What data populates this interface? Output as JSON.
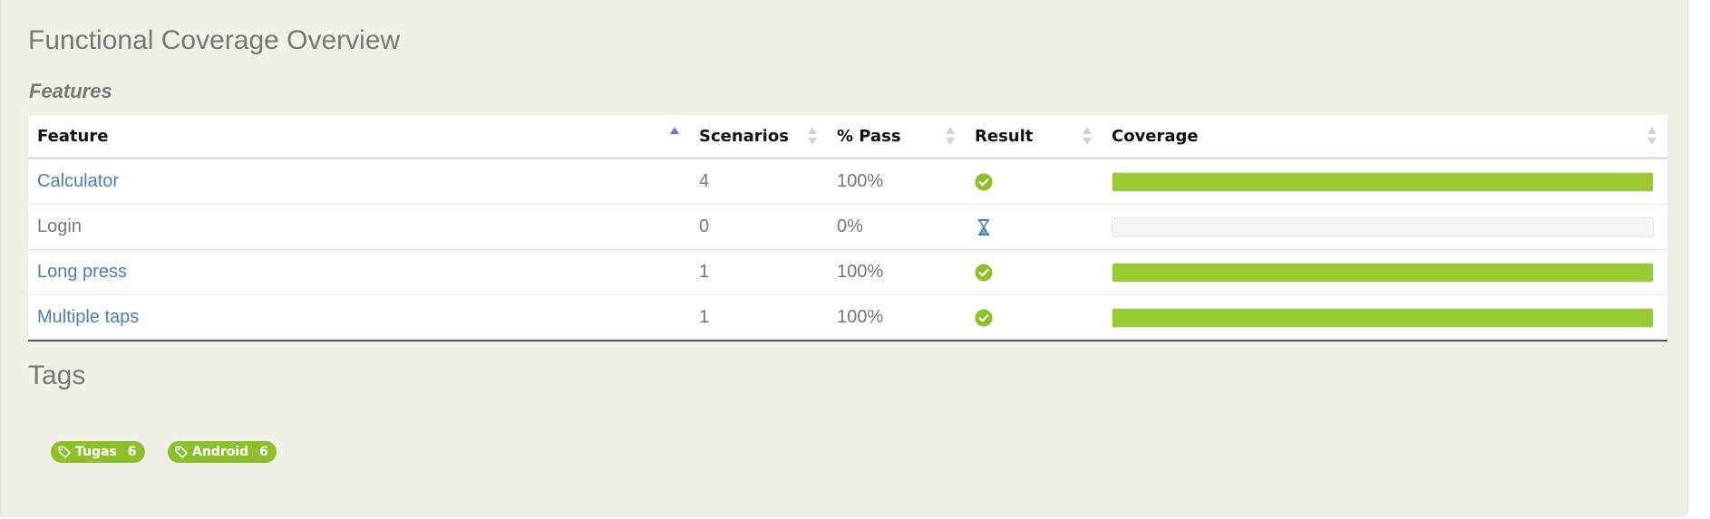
{
  "page": {
    "title": "Functional Coverage Overview",
    "subtitle": "Features"
  },
  "table": {
    "headers": [
      "Feature",
      "Scenarios",
      "% Pass",
      "Result",
      "Coverage"
    ],
    "rows": [
      {
        "feature": "Calculator",
        "scenarios": "4",
        "pass": "100%",
        "result": "passed",
        "coverage": 1.0,
        "linked": true
      },
      {
        "feature": "Login",
        "scenarios": "0",
        "pass": "0%",
        "result": "pending",
        "coverage": 0.0,
        "linked": false
      },
      {
        "feature": "Long press",
        "scenarios": "1",
        "pass": "100%",
        "result": "passed",
        "coverage": 1.0,
        "linked": true
      },
      {
        "feature": "Multiple taps",
        "scenarios": "1",
        "pass": "100%",
        "result": "passed",
        "coverage": 1.0,
        "linked": true
      }
    ]
  },
  "tags": {
    "title": "Tags",
    "items": [
      {
        "label": "Tugas",
        "count": "6"
      },
      {
        "label": "Android",
        "count": "6"
      }
    ]
  },
  "colors": {
    "accent_green": "#9ac930",
    "link_blue": "#4a7fb5",
    "sort_active": "#6f7bd4"
  }
}
